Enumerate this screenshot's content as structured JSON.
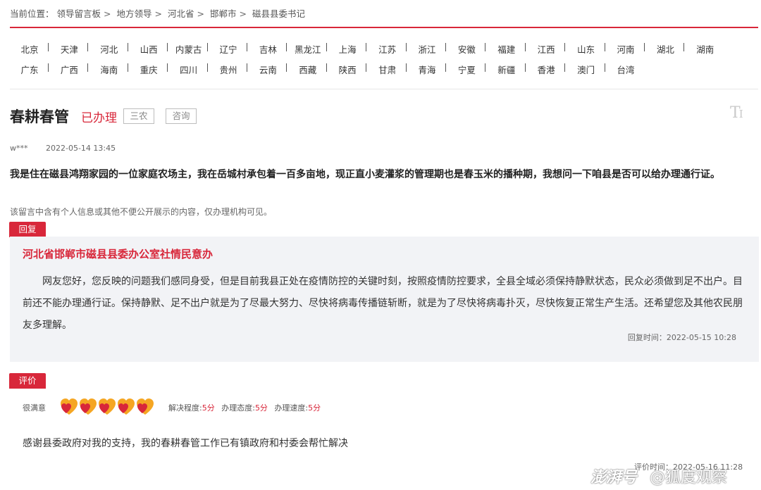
{
  "breadcrumb": {
    "prefix": "当前位置：",
    "items": [
      "领导留言板",
      "地方领导",
      "河北省",
      "邯郸市",
      "磁县县委书记"
    ],
    "separator": ">"
  },
  "regions": {
    "row1": [
      "北京",
      "天津",
      "河北",
      "山西",
      "内蒙古",
      "辽宁",
      "吉林",
      "黑龙江",
      "上海",
      "江苏",
      "浙江",
      "安徽",
      "福建",
      "江西",
      "山东",
      "河南",
      "湖北",
      "湖南"
    ],
    "row2": [
      "广东",
      "广西",
      "海南",
      "重庆",
      "四川",
      "贵州",
      "云南",
      "西藏",
      "陕西",
      "甘肃",
      "青海",
      "宁夏",
      "新疆",
      "香港",
      "澳门",
      "台湾"
    ]
  },
  "message": {
    "title": "春耕春管",
    "status": "已办理",
    "tags": [
      "三农",
      "咨询"
    ],
    "font_toggle_label": "T",
    "user": "w***",
    "date": "2022-05-14 13:45",
    "body": "我是住在磁县鸿翔家园的一位家庭农场主，我在岳城村承包着一百多亩地，现正直小麦灌浆的管理期也是春玉米的播种期，我想问一下咱县是否可以给办理通行证。",
    "privacy_note": "该留言中含有个人信息或其他不便公开展示的内容，仅办理机构可见。"
  },
  "reply": {
    "tab_label": "回复",
    "org": "河北省邯郸市磁县县委办公室社情民意办",
    "body": "网友您好，您反映的问题我们感同身受，但是目前我县正处在疫情防控的关键时刻，按照疫情防控要求，全县全域必须保持静默状态，民众必须做到足不出户。目前还不能办理通行证。保持静默、足不出户就是为了尽最大努力、尽快将病毒传播链斩断，就是为了尽快将病毒扑灭，尽快恢复正常生产生活。还希望您及其他农民朋友多理解。",
    "time": "回复时间：2022-05-15 10:28"
  },
  "evaluation": {
    "tab_label": "评价",
    "satisfaction": "很满意",
    "hearts": 5,
    "hearts_max": 5,
    "heart_colors": {
      "outer": "#f5a623",
      "inner": "#d8273a"
    },
    "scores": [
      {
        "label": "解决程度:",
        "value": "5分"
      },
      {
        "label": "办理态度:",
        "value": "5分"
      },
      {
        "label": "办理速度:",
        "value": "5分"
      }
    ],
    "text": "感谢县委政府对我的支持，我的春耕春管工作已有镇政府和村委会帮忙解决",
    "time": "评价时间：2022-05-16 11:28"
  },
  "watermark": {
    "text1": "澎湃号",
    "text2": "@狐度观察"
  },
  "colors": {
    "accent": "#d8273a"
  }
}
